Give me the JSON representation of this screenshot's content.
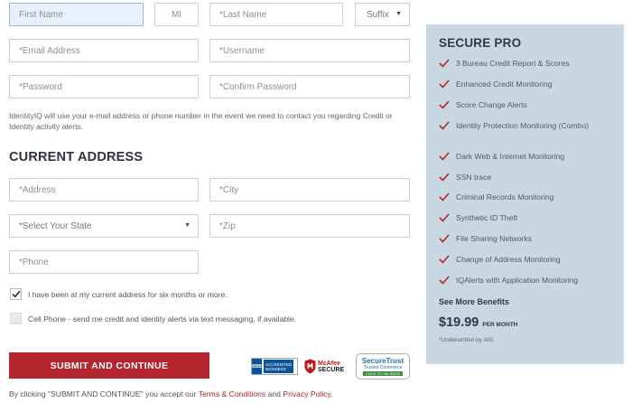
{
  "form": {
    "first_name": {
      "placeholder": "First Name"
    },
    "mi": {
      "placeholder": "MI"
    },
    "last_name": {
      "placeholder": "*Last Name"
    },
    "suffix": {
      "label": "Suffix"
    },
    "email": {
      "placeholder": "*Email Address"
    },
    "username": {
      "placeholder": "*Username"
    },
    "password": {
      "placeholder": "*Password"
    },
    "confirm_password": {
      "placeholder": "*Confirm Password"
    },
    "note": "IdentityIQ will use your e-mail address or phone number in the event we need to contact you regarding Credit or Identity activity alerts.",
    "section_title": "CURRENT ADDRESS",
    "address": {
      "placeholder": "*Address"
    },
    "city": {
      "placeholder": "*City"
    },
    "state": {
      "label": "*Select Your State"
    },
    "zip": {
      "placeholder": "*Zip"
    },
    "phone": {
      "placeholder": "*Phone"
    },
    "six_months": {
      "label": "I have been at my current address for six months or more.",
      "checked": true
    },
    "cell_alerts": {
      "label": "Cell Phone - send me credit and identity alerts via text messaging, if available.",
      "checked": false
    },
    "submit_label": "SUBMIT AND CONTINUE"
  },
  "badges": {
    "bbb": {
      "line1": "ACCREDITED",
      "line2": "BUSINESS",
      "logo": "BBB"
    },
    "mcafee": {
      "line1": "McAfee",
      "line2": "SECURE"
    },
    "securetrust": {
      "line1": "SecureTrust",
      "line2": "Trusted Commerce",
      "line3": "CLICK TO VALIDATE"
    }
  },
  "legal": {
    "prefix": "By clicking \"SUBMIT AND CONTINUE\" you accept our ",
    "terms": "Terms & Conditions",
    "and": " and ",
    "privacy": "Privacy Policy",
    "suffix": "."
  },
  "plan": {
    "title": "SECURE PRO",
    "benefits": [
      "3 Bureau Credit Report & Scores",
      "Enhanced Credit Monitoring",
      "Score Change Alerts",
      "Identity Protection Monitoring (Combo)",
      "Dark Web & Internet Monitoring",
      "SSN trace",
      "Criminal Records Monitoring",
      "Synthetic ID Theft",
      "File Sharing Networks",
      "Change of Address Monitoring",
      "IQAlerts with Application Monitoring"
    ],
    "see_more": "See More Benefits",
    "price": "$19.99",
    "per": "PER MONTH",
    "underwritten": "*Underwritten by AIG"
  },
  "colors": {
    "accent": "#b5252f",
    "panel": "#c9d7e3",
    "check_mark": "#b5252f"
  }
}
